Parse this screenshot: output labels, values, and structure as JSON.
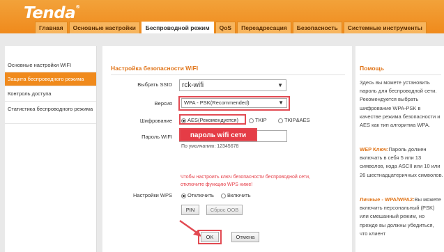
{
  "header": {
    "logo": "Tenda",
    "logo_mark": "®",
    "tabs": [
      {
        "label": "Главная"
      },
      {
        "label": "Основные настройки"
      },
      {
        "label": "Беспроводной режим"
      },
      {
        "label": "QoS"
      },
      {
        "label": "Переадресация"
      },
      {
        "label": "Безопасность"
      },
      {
        "label": "Системные инструменты"
      }
    ]
  },
  "sidebar": {
    "items": [
      {
        "label": "Основные настройки WIFI"
      },
      {
        "label": "Защита беспроводного режима"
      },
      {
        "label": "Контроль доступа"
      },
      {
        "label": "Статистика беспроводного режима"
      }
    ]
  },
  "main": {
    "section_title": "Настройка безопасности WIFI",
    "ssid_label": "Выбрать SSID",
    "ssid_value": "rck-wifi",
    "version_label": "Версия",
    "version_value": "WPA - PSK(Recommended)",
    "cipher_label": "Шифрование",
    "cipher_options": [
      "AES(Рекомендуется)",
      "TKIP",
      "TKIP&AES"
    ],
    "password_label": "Пароль WIFI",
    "password_annotation": "пароль wifi сети",
    "default_hint": "По умолчанию: 12345678",
    "wps_warning": "Чтобы настроить ключ безопасности беспроводной сети, отключите функцию WPS ниже!",
    "wps_label": "Настройки WPS",
    "wps_options": [
      "Отключить",
      "Включить"
    ],
    "pin_button": "PIN",
    "reset_oob_button": "Сброс OOB",
    "ok_button": "OK",
    "cancel_button": "Отмена"
  },
  "help": {
    "title": "Помощь",
    "p1": "Здесь вы можете установить пароль для беспроводной сети. Рекомендуется выбрать шифрование WPA-PSK в качестве режима безопасности и AES как тип алгоритма WPA.",
    "p2_title": "WEP Ключ:",
    "p2": "Пароль должен включать в себя 5 или 13 символов, кода ASCII или 10 или 26 шестнадцатеричных символов.",
    "p3_title": "Личные - WPA/WPA2:",
    "p3": "Вы можете включить персональный (PSK) или смешанный режим, но прежде вы должны убедиться, что клиент"
  },
  "colors": {
    "brand_orange": "#f08a1c",
    "annotation_red": "#e24a52"
  }
}
